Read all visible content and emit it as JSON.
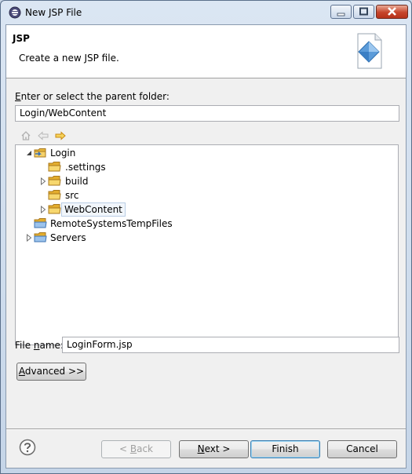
{
  "window": {
    "title": "New JSP File"
  },
  "banner": {
    "title": "JSP",
    "description": "Create a new JSP file."
  },
  "parent_folder": {
    "label_pre": "",
    "label_mnemonic": "E",
    "label_post": "nter or select the parent folder:",
    "value": "Login/WebContent"
  },
  "tree": {
    "items": [
      {
        "label": "Login",
        "expanded": true,
        "level": 0,
        "icon": "project-icon"
      },
      {
        "label": ".settings",
        "level": 1,
        "icon": "folder-icon"
      },
      {
        "label": "build",
        "level": 1,
        "icon": "folder-icon",
        "collapsed": true
      },
      {
        "label": "src",
        "level": 1,
        "icon": "folder-icon"
      },
      {
        "label": "WebContent",
        "level": 1,
        "icon": "folder-icon",
        "collapsed": true,
        "selected": true
      },
      {
        "label": "RemoteSystemsTempFiles",
        "level": 0,
        "icon": "project-icon"
      },
      {
        "label": "Servers",
        "level": 0,
        "icon": "project-icon",
        "collapsed": true
      }
    ]
  },
  "file_name": {
    "label_pre": "File ",
    "label_mnemonic": "n",
    "label_post": "ame:",
    "value": "LoginForm.jsp"
  },
  "buttons": {
    "advanced_mnemonic": "A",
    "advanced_rest": "dvanced >>",
    "back_pre": "< ",
    "back_mnemonic": "B",
    "back_rest": "ack",
    "next_mnemonic": "N",
    "next_rest": "ext >",
    "finish": "Finish",
    "cancel": "Cancel"
  },
  "colors": {
    "folder": "#e8b83c",
    "selection_border": "#b9cde4",
    "default_button_border": "#3c7fb1"
  }
}
